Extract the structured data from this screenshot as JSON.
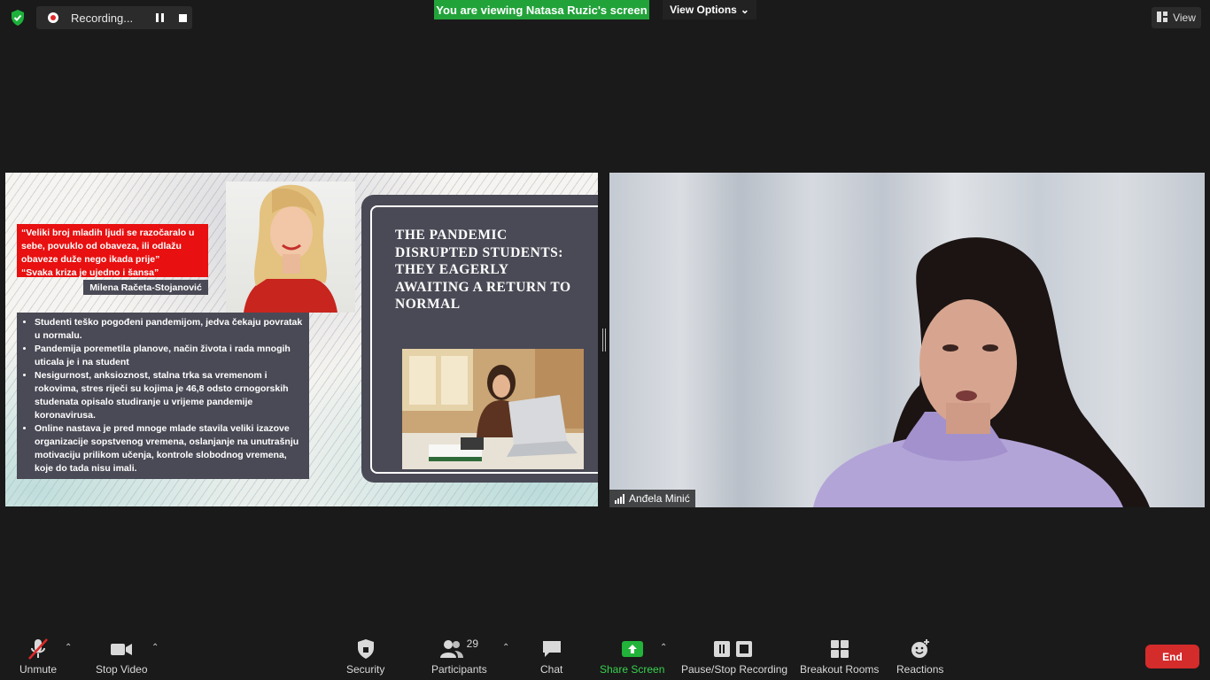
{
  "recording": {
    "label": "Recording..."
  },
  "banner": {
    "text": "You are viewing Natasa Ruzic's screen",
    "view_options": "View Options"
  },
  "view_button": {
    "label": "View"
  },
  "slide": {
    "quote_lines": [
      "“Veliki broj mladih ljudi se razočaralo u",
      "sebe, povuklo od obaveza, ili odlažu",
      "obaveze duže nego ikada prije”",
      "“Svaka kriza je ujedno i šansa”"
    ],
    "author": "Milena Račeta-Stojanović",
    "bullets": [
      "Studenti teško pogođeni pandemijom, jedva čekaju povratak u normalu.",
      "Pandemija poremetila planove, način života i rada mnogih uticala je i na student",
      "Nesigurnost, anksioznost,  stalna trka sa vremenom i rokovima, stres riječi su kojima je 46,8 odsto crnogorskih studenata opisalo studiranje u vrijeme pandemije koronavirusa.",
      "Online nastava je pred mnoge mlade stavila veliki izazove organizacije sopstvenog vremena, oslanjanje na unutrašnju motivaciju prilikom učenja, kontrole slobodnog vremena, koje do tada nisu imali."
    ],
    "title": "THE PANDEMIC DISRUPTED STUDENTS: THEY EAGERLY AWAITING A RETURN TO NORMAL"
  },
  "participant": {
    "name": "Anđela Minić"
  },
  "toolbar": {
    "unmute": "Unmute",
    "stop_video": "Stop Video",
    "security": "Security",
    "participants": "Participants",
    "participants_count": "29",
    "chat": "Chat",
    "share_screen": "Share Screen",
    "pause_stop_recording": "Pause/Stop Recording",
    "breakout_rooms": "Breakout Rooms",
    "reactions": "Reactions",
    "end": "End"
  },
  "colors": {
    "share_green": "#22b33a",
    "end_red": "#d42b2b",
    "banner_green": "#22a33a",
    "slide_panel": "#4a4a56",
    "quote_red": "#e81010"
  },
  "icons": [
    "shield-check-icon",
    "record-icon",
    "pause-icon",
    "stop-icon",
    "grid-view-icon",
    "chevron-down-icon",
    "mic-muted-icon",
    "video-camera-icon",
    "shield-icon",
    "participants-icon",
    "chat-bubble-icon",
    "share-screen-icon",
    "pause-stop-recording-icon",
    "breakout-rooms-icon",
    "reactions-icon",
    "signal-icon"
  ]
}
